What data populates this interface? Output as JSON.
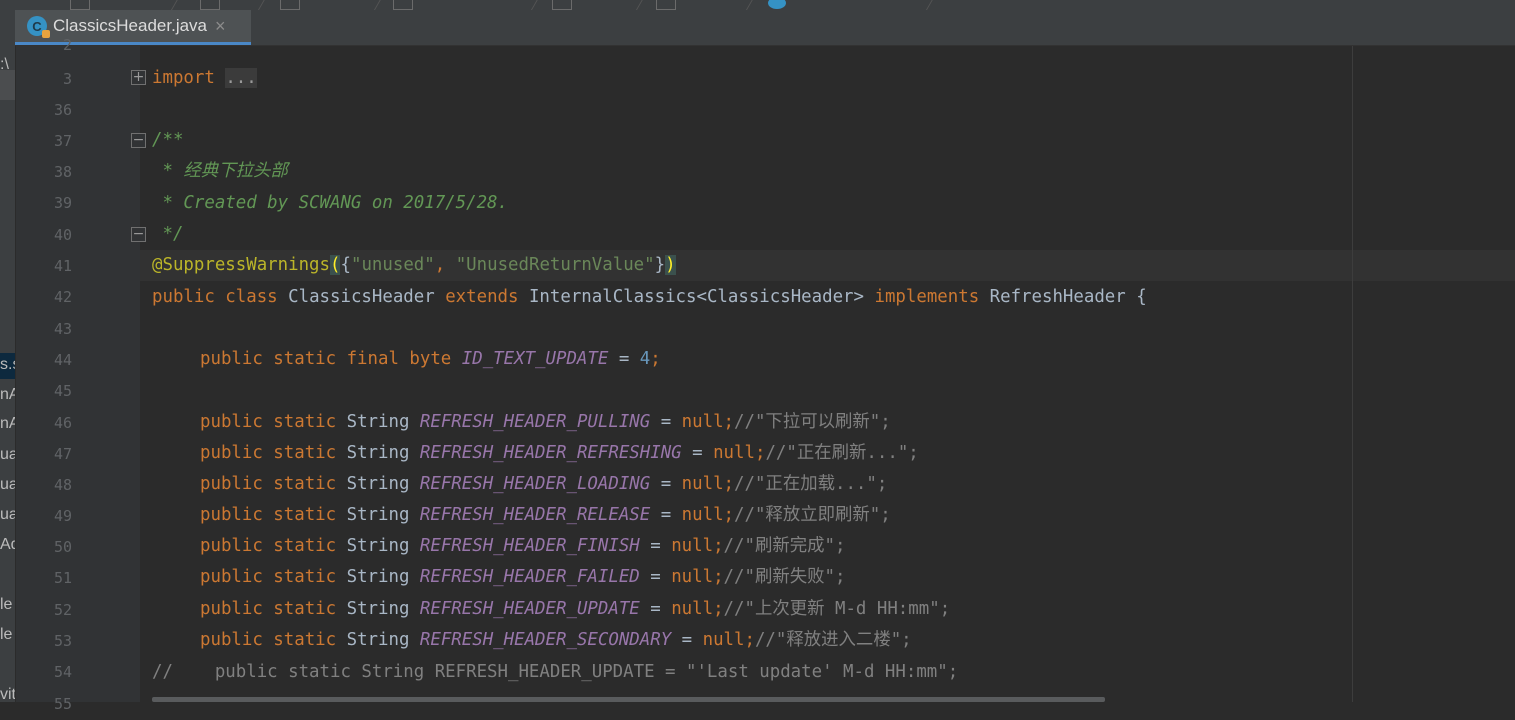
{
  "tab": {
    "icon": "class-file-icon",
    "filename": "ClassicsHeader.java",
    "close": "×"
  },
  "left_fragments": [
    ":\\",
    "s.s",
    "nA",
    "nA",
    "ua",
    "ua",
    "ua",
    "Ad",
    "le",
    "le",
    "vit"
  ],
  "code": {
    "l2": {
      "num": "2"
    },
    "l3": {
      "num": "3",
      "kw": "import",
      "folded": "..."
    },
    "l36": {
      "num": "36"
    },
    "l37": {
      "num": "37",
      "c": "/**"
    },
    "l38": {
      "num": "38",
      "c": " * 经典下拉头部"
    },
    "l39": {
      "num": "39",
      "c": " * Created by SCWANG on 2017/5/28."
    },
    "l40": {
      "num": "40",
      "c": " */"
    },
    "l41": {
      "num": "41",
      "ann": "@SuppressWarnings",
      "p1": "(",
      "b1": "{",
      "s1": "\"unused\"",
      "comma": ", ",
      "s2": "\"UnusedReturnValue\"",
      "b2": "}",
      "p2": ")"
    },
    "l42": {
      "num": "42",
      "kw1": "public class ",
      "cls": "ClassicsHeader ",
      "kw2": "extends ",
      "sup": "InternalClassics<ClassicsHeader> ",
      "kw3": "implements ",
      "iface": "RefreshHeader {"
    },
    "l43": {
      "num": "43"
    },
    "l44": {
      "num": "44",
      "kw": "public static final byte ",
      "fld": "ID_TEXT_UPDATE",
      "eq": " = ",
      "val": "4",
      "semi": ";"
    },
    "l45": {
      "num": "45"
    },
    "l46": {
      "num": "46",
      "kw": "public static ",
      "type": "String ",
      "fld": "REFRESH_HEADER_PULLING",
      "eq": " = ",
      "nul": "null;",
      "cmt": "//\"下拉可以刷新\";"
    },
    "l47": {
      "num": "47",
      "kw": "public static ",
      "type": "String ",
      "fld": "REFRESH_HEADER_REFRESHING",
      "eq": " = ",
      "nul": "null;",
      "cmt": "//\"正在刷新...\";"
    },
    "l48": {
      "num": "48",
      "kw": "public static ",
      "type": "String ",
      "fld": "REFRESH_HEADER_LOADING",
      "eq": " = ",
      "nul": "null;",
      "cmt": "//\"正在加载...\";"
    },
    "l49": {
      "num": "49",
      "kw": "public static ",
      "type": "String ",
      "fld": "REFRESH_HEADER_RELEASE",
      "eq": " = ",
      "nul": "null;",
      "cmt": "//\"释放立即刷新\";"
    },
    "l50": {
      "num": "50",
      "kw": "public static ",
      "type": "String ",
      "fld": "REFRESH_HEADER_FINISH",
      "eq": " = ",
      "nul": "null;",
      "cmt": "//\"刷新完成\";"
    },
    "l51": {
      "num": "51",
      "kw": "public static ",
      "type": "String ",
      "fld": "REFRESH_HEADER_FAILED",
      "eq": " = ",
      "nul": "null;",
      "cmt": "//\"刷新失败\";"
    },
    "l52": {
      "num": "52",
      "kw": "public static ",
      "type": "String ",
      "fld": "REFRESH_HEADER_UPDATE",
      "eq": " = ",
      "nul": "null;",
      "cmt": "//\"上次更新 M-d HH:mm\";"
    },
    "l53": {
      "num": "53",
      "kw": "public static ",
      "type": "String ",
      "fld": "REFRESH_HEADER_SECONDARY",
      "eq": " = ",
      "nul": "null;",
      "cmt": "//\"释放进入二楼\";"
    },
    "l54": {
      "num": "54",
      "cmt": "//    public static String REFRESH_HEADER_UPDATE = \"'Last update' M-d HH:mm\";"
    }
  },
  "colors": {
    "background": "#2b2b2b",
    "keyword": "#cc7832",
    "string": "#6a8759",
    "field": "#9876aa",
    "annotation": "#bbb529",
    "number": "#6897bb",
    "comment": "#808080",
    "doc_comment": "#629755",
    "tab_accent": "#4a88c7"
  }
}
